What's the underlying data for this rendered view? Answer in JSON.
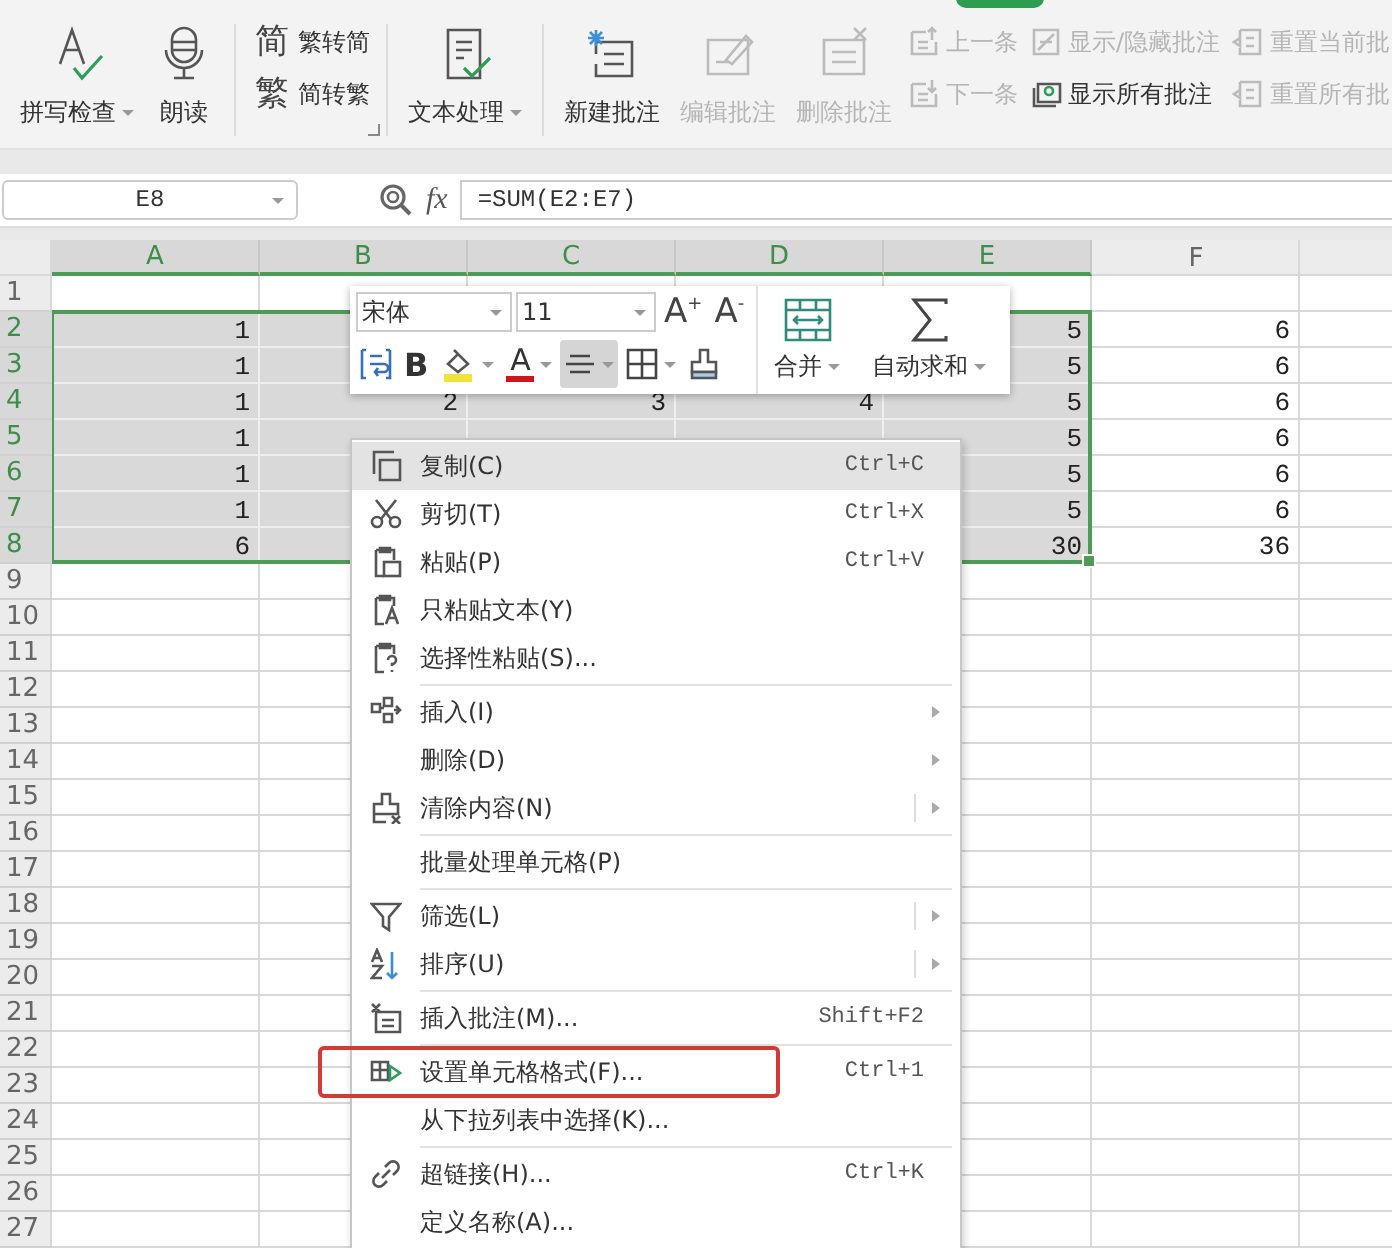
{
  "ribbon": {
    "groups": [
      {
        "items": [
          {
            "kind": "large",
            "label": "拼写检查",
            "dropdown": true,
            "disabled": false
          },
          {
            "kind": "large",
            "label": "朗读",
            "dropdown": false,
            "disabled": false
          }
        ]
      },
      {
        "launcher": true,
        "items": [
          {
            "kind": "stack",
            "entries": [
              {
                "glyph": "简",
                "label": "繁转简",
                "disabled": false
              },
              {
                "glyph": "繁",
                "label": "简转繁",
                "disabled": false
              }
            ]
          }
        ]
      },
      {
        "items": [
          {
            "kind": "large",
            "label": "文本处理",
            "dropdown": true,
            "disabled": false
          }
        ]
      },
      {
        "items": [
          {
            "kind": "large",
            "label": "新建批注",
            "dropdown": false,
            "disabled": false
          },
          {
            "kind": "large",
            "label": "编辑批注",
            "dropdown": false,
            "disabled": true
          },
          {
            "kind": "large",
            "label": "删除批注",
            "dropdown": false,
            "disabled": true
          },
          {
            "kind": "stack",
            "entries": [
              {
                "label": "上一条",
                "disabled": true
              },
              {
                "label": "下一条",
                "disabled": true
              }
            ]
          },
          {
            "kind": "stack",
            "entries": [
              {
                "label": "显示/隐藏批注",
                "disabled": true
              },
              {
                "label": "显示所有批注",
                "disabled": false
              }
            ]
          },
          {
            "kind": "stack",
            "entries": [
              {
                "label": "重置当前批",
                "disabled": true
              },
              {
                "label": "重置所有批",
                "disabled": true
              }
            ]
          }
        ]
      }
    ]
  },
  "formula_bar": {
    "name_box": "E8",
    "fx": "fx",
    "formula": "=SUM(E2:E7)"
  },
  "sheet": {
    "columns": [
      {
        "label": "A",
        "selected": true
      },
      {
        "label": "B",
        "selected": true
      },
      {
        "label": "C",
        "selected": true
      },
      {
        "label": "D",
        "selected": true
      },
      {
        "label": "E",
        "selected": true
      },
      {
        "label": "F",
        "selected": false
      }
    ],
    "rows": [
      {
        "label": "1",
        "selected": false,
        "cells": [
          null,
          null,
          null,
          null,
          null,
          null
        ]
      },
      {
        "label": "2",
        "selected": true,
        "cells": [
          "1",
          null,
          null,
          null,
          "5",
          "6"
        ]
      },
      {
        "label": "3",
        "selected": true,
        "cells": [
          "1",
          null,
          null,
          null,
          "5",
          "6"
        ]
      },
      {
        "label": "4",
        "selected": true,
        "cells": [
          "1",
          "2",
          "3",
          "4",
          "5",
          "6"
        ]
      },
      {
        "label": "5",
        "selected": true,
        "cells": [
          "1",
          null,
          null,
          null,
          "5",
          "6"
        ]
      },
      {
        "label": "6",
        "selected": true,
        "cells": [
          "1",
          null,
          null,
          null,
          "5",
          "6"
        ]
      },
      {
        "label": "7",
        "selected": true,
        "cells": [
          "1",
          null,
          null,
          null,
          "5",
          "6"
        ]
      },
      {
        "label": "8",
        "selected": true,
        "cells": [
          "6",
          null,
          null,
          null,
          "30",
          "36"
        ]
      },
      {
        "label": "9",
        "selected": false,
        "cells": [
          null,
          null,
          null,
          null,
          null,
          null
        ]
      },
      {
        "label": "10",
        "selected": false,
        "cells": [
          null,
          null,
          null,
          null,
          null,
          null
        ]
      },
      {
        "label": "11",
        "selected": false,
        "cells": [
          null,
          null,
          null,
          null,
          null,
          null
        ]
      },
      {
        "label": "12",
        "selected": false,
        "cells": [
          null,
          null,
          null,
          null,
          null,
          null
        ]
      },
      {
        "label": "13",
        "selected": false,
        "cells": [
          null,
          null,
          null,
          null,
          null,
          null
        ]
      },
      {
        "label": "14",
        "selected": false,
        "cells": [
          null,
          null,
          null,
          null,
          null,
          null
        ]
      },
      {
        "label": "15",
        "selected": false,
        "cells": [
          null,
          null,
          null,
          null,
          null,
          null
        ]
      },
      {
        "label": "16",
        "selected": false,
        "cells": [
          null,
          null,
          null,
          null,
          null,
          null
        ]
      },
      {
        "label": "17",
        "selected": false,
        "cells": [
          null,
          null,
          null,
          null,
          null,
          null
        ]
      },
      {
        "label": "18",
        "selected": false,
        "cells": [
          null,
          null,
          null,
          null,
          null,
          null
        ]
      },
      {
        "label": "19",
        "selected": false,
        "cells": [
          null,
          null,
          null,
          null,
          null,
          null
        ]
      },
      {
        "label": "20",
        "selected": false,
        "cells": [
          null,
          null,
          null,
          null,
          null,
          null
        ]
      },
      {
        "label": "21",
        "selected": false,
        "cells": [
          null,
          null,
          null,
          null,
          null,
          null
        ]
      },
      {
        "label": "22",
        "selected": false,
        "cells": [
          null,
          null,
          null,
          null,
          null,
          null
        ]
      },
      {
        "label": "23",
        "selected": false,
        "cells": [
          null,
          null,
          null,
          null,
          null,
          null
        ]
      },
      {
        "label": "24",
        "selected": false,
        "cells": [
          null,
          null,
          null,
          null,
          null,
          null
        ]
      },
      {
        "label": "25",
        "selected": false,
        "cells": [
          null,
          null,
          null,
          null,
          null,
          null
        ]
      },
      {
        "label": "26",
        "selected": false,
        "cells": [
          null,
          null,
          null,
          null,
          null,
          null
        ]
      },
      {
        "label": "27",
        "selected": false,
        "cells": [
          null,
          null,
          null,
          null,
          null,
          null
        ]
      }
    ]
  },
  "mini_toolbar": {
    "font": "宋体",
    "size": "11",
    "grow": "A$^{+}$",
    "shrink": "A$^{-}$",
    "tools": [
      {
        "kind": "wrap",
        "pressed": false,
        "dropdown": false
      },
      {
        "kind": "bold",
        "label": "B",
        "pressed": false,
        "dropdown": false
      },
      {
        "kind": "fill",
        "pressed": false,
        "dropdown": true
      },
      {
        "kind": "font_color",
        "label": "A",
        "pressed": false,
        "dropdown": true
      },
      {
        "kind": "align",
        "pressed": true,
        "dropdown": true
      },
      {
        "kind": "borders",
        "pressed": false,
        "dropdown": true
      },
      {
        "kind": "painter",
        "pressed": false,
        "dropdown": false
      }
    ],
    "blocks": [
      {
        "kind": "merge",
        "label": "合并",
        "dropdown": true
      },
      {
        "kind": "sum",
        "label": "自动求和",
        "dropdown": true
      }
    ]
  },
  "context_menu": {
    "items": [
      {
        "kind": "plain",
        "label": "复制(C)",
        "shortcut": "Ctrl+C",
        "hovered": true,
        "separator_after": false,
        "annotated": false
      },
      {
        "kind": "plain",
        "label": "剪切(T)",
        "shortcut": "Ctrl+X",
        "hovered": false,
        "separator_after": false,
        "annotated": false
      },
      {
        "kind": "plain",
        "label": "粘贴(P)",
        "shortcut": "Ctrl+V",
        "hovered": false,
        "separator_after": false,
        "annotated": false
      },
      {
        "kind": "plain",
        "label": "只粘贴文本(Y)",
        "hovered": false,
        "separator_after": false,
        "annotated": false
      },
      {
        "kind": "plain",
        "label": "选择性粘贴(S)...",
        "hovered": false,
        "separator_after": true,
        "annotated": false
      },
      {
        "kind": "submenu",
        "label": "插入(I)",
        "hovered": false,
        "separator_after": false,
        "annotated": false
      },
      {
        "kind": "submenu",
        "label": "删除(D)",
        "hovered": false,
        "separator_after": false,
        "annotated": false
      },
      {
        "kind": "split",
        "label": "清除内容(N)",
        "hovered": false,
        "separator_after": true,
        "annotated": false
      },
      {
        "kind": "plain",
        "label": "批量处理单元格(P)",
        "hovered": false,
        "separator_after": true,
        "annotated": false
      },
      {
        "kind": "split",
        "label": "筛选(L)",
        "hovered": false,
        "separator_after": false,
        "annotated": false
      },
      {
        "kind": "split",
        "label": "排序(U)",
        "hovered": false,
        "separator_after": true,
        "annotated": false
      },
      {
        "kind": "plain",
        "label": "插入批注(M)...",
        "shortcut": "Shift+F2",
        "hovered": false,
        "separator_after": true,
        "annotated": false
      },
      {
        "kind": "plain",
        "label": "设置单元格格式(F)...",
        "shortcut": "Ctrl+1",
        "hovered": false,
        "separator_after": false,
        "annotated": true
      },
      {
        "kind": "plain",
        "label": "从下拉列表中选择(K)...",
        "hovered": false,
        "separator_after": true,
        "annotated": false
      },
      {
        "kind": "plain",
        "label": "超链接(H)...",
        "shortcut": "Ctrl+K",
        "hovered": false,
        "separator_after": false,
        "annotated": false
      },
      {
        "kind": "plain",
        "label": "定义名称(A)...",
        "hovered": false,
        "separator_after": false,
        "annotated": false
      }
    ]
  }
}
